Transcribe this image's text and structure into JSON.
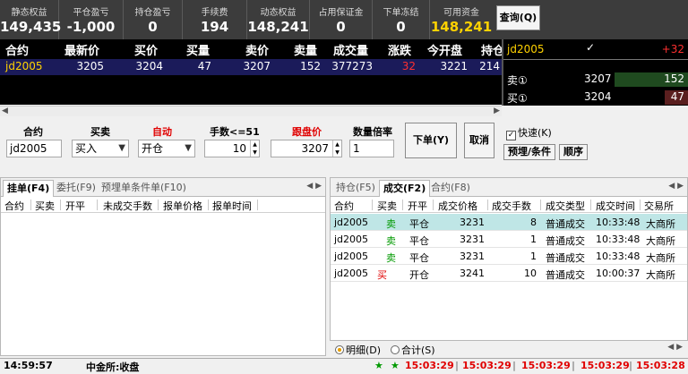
{
  "account": {
    "static_equity_label": "静态权益",
    "static_equity": "149,435",
    "close_pnl_label": "平仓盈亏",
    "close_pnl": "-1,000",
    "position_pnl_label": "持仓盈亏",
    "position_pnl": "0",
    "fee_label": "手续费",
    "fee": "194",
    "dynamic_equity_label": "动态权益",
    "dynamic_equity": "148,241",
    "margin_label": "占用保证金",
    "margin": "0",
    "frozen_label": "下单冻结",
    "frozen": "0",
    "available_label": "可用资金",
    "available": "148,241",
    "query_button": "查询(Q)"
  },
  "quote": {
    "headers": [
      "合约",
      "最新价",
      "买价",
      "买量",
      "卖价",
      "卖量",
      "成交量",
      "涨跌",
      "今开盘",
      "持仓"
    ],
    "row": {
      "symbol": "jd2005",
      "last": "3205",
      "bid": "3204",
      "bid_vol": "47",
      "ask": "3207",
      "ask_vol": "152",
      "volume": "377273",
      "change": "32",
      "open": "3221",
      "oi": "214"
    }
  },
  "depth": {
    "symbol": "jd2005",
    "check": "✓",
    "change": "+32",
    "ask_label": "卖①",
    "ask_price": "3207",
    "ask_vol": "152",
    "bid_label": "买①",
    "bid_price": "3204",
    "bid_vol": "47"
  },
  "order": {
    "contract_label": "合约",
    "contract": "jd2005",
    "side_label": "买卖",
    "side": "买入",
    "offset_label": "自动",
    "offset": "开仓",
    "qty_label": "手数<=51",
    "qty": "10",
    "price_label": "跟盘价",
    "price": "3207",
    "mult_label": "数量倍率",
    "mult": "1",
    "submit_button": "下单(Y)",
    "cancel_button": "取消",
    "quick_label": "快速(K)",
    "preset_button": "预埋/条件",
    "sequence_button": "顺序"
  },
  "left_pane": {
    "tabs": [
      "挂单(F4)",
      "委托(F9)",
      "预埋单条件单(F10)"
    ],
    "columns": [
      "合约",
      "买卖",
      "开平",
      "未成交手数",
      "报单价格",
      "报单时间"
    ]
  },
  "right_pane": {
    "tabs": [
      "持仓(F5)",
      "成交(F2)",
      "合约(F8)"
    ],
    "columns": [
      "合约",
      "买卖",
      "开平",
      "成交价格",
      "成交手数",
      "成交类型",
      "成交时间",
      "交易所"
    ],
    "rows": [
      {
        "contract": "jd2005",
        "side": "卖",
        "offset": "平仓",
        "price": "3231",
        "qty": "8",
        "type": "普通成交",
        "time": "10:33:48",
        "exchange": "大商所"
      },
      {
        "contract": "jd2005",
        "side": "卖",
        "offset": "平仓",
        "price": "3231",
        "qty": "1",
        "type": "普通成交",
        "time": "10:33:48",
        "exchange": "大商所"
      },
      {
        "contract": "jd2005",
        "side": "卖",
        "offset": "平仓",
        "price": "3231",
        "qty": "1",
        "type": "普通成交",
        "time": "10:33:48",
        "exchange": "大商所"
      },
      {
        "contract": "jd2005",
        "side": "买",
        "offset": "开仓",
        "price": "3241",
        "qty": "10",
        "type": "普通成交",
        "time": "10:00:37",
        "exchange": "大商所"
      }
    ],
    "detail_label": "明细(D)",
    "total_label": "合计(S)"
  },
  "status": {
    "clock": "14:59:57",
    "exchange_status": "中金所:收盘",
    "times": [
      "15:03:29",
      "15:03:29",
      "15:03:29",
      "15:03:29",
      "15:03:28"
    ]
  },
  "colors": {
    "bg_dark": "#3c3c3c",
    "available": "#ffd200",
    "sell": "#009900",
    "buy": "#e00000",
    "selected_row": "#bfe6e6"
  }
}
